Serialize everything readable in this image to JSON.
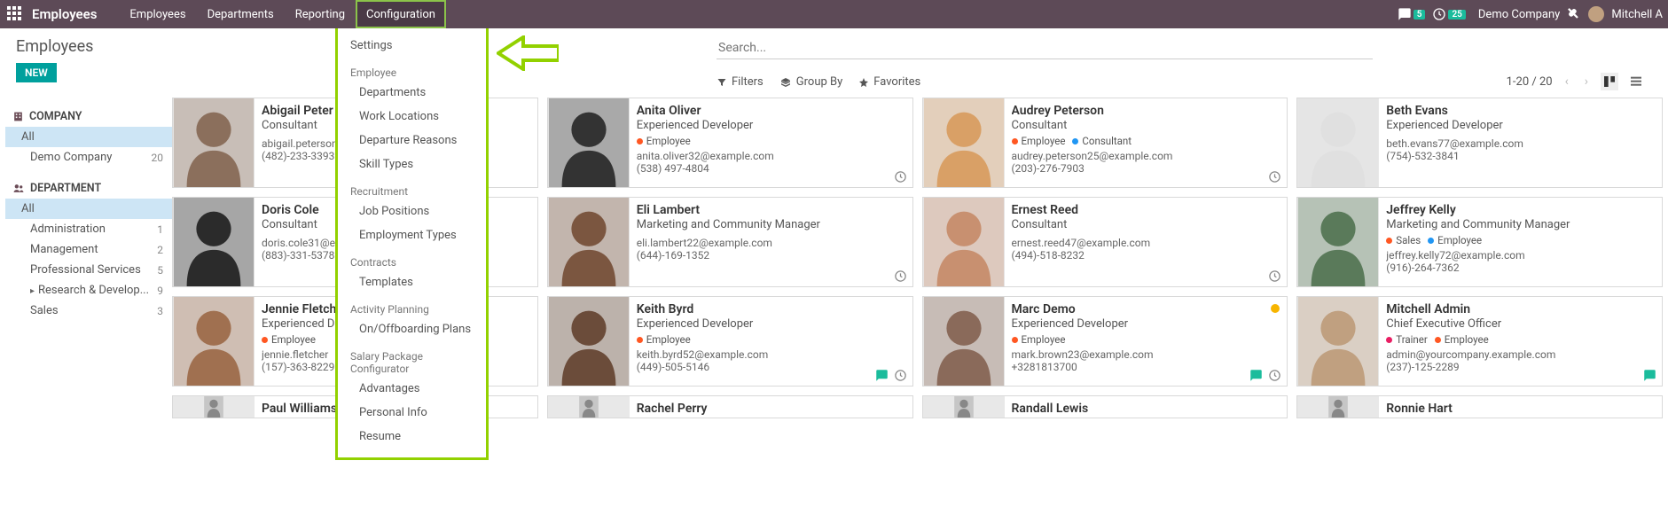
{
  "topnav": {
    "brand": "Employees",
    "items": [
      "Employees",
      "Departments",
      "Reporting",
      "Configuration"
    ],
    "msg_count": "5",
    "clock_count": "25",
    "company": "Demo Company",
    "user": "Mitchell A"
  },
  "page": {
    "title": "Employees",
    "new_btn": "NEW",
    "search_placeholder": "Search..."
  },
  "filters": {
    "filters": "Filters",
    "group_by": "Group By",
    "favorites": "Favorites",
    "pager": "1-20 / 20"
  },
  "config_menu": {
    "settings": "Settings",
    "groups": [
      {
        "label": "Employee",
        "items": [
          "Departments",
          "Work Locations",
          "Departure Reasons",
          "Skill Types"
        ]
      },
      {
        "label": "Recruitment",
        "items": [
          "Job Positions",
          "Employment Types"
        ]
      },
      {
        "label": "Contracts",
        "items": [
          "Templates"
        ]
      },
      {
        "label": "Activity Planning",
        "items": [
          "On/Offboarding Plans"
        ]
      },
      {
        "label": "Salary Package Configurator",
        "items": [
          "Advantages",
          "Personal Info",
          "Resume"
        ]
      }
    ]
  },
  "sidebar": {
    "company": {
      "head": "COMPANY",
      "all": "All",
      "items": [
        {
          "l": "Demo Company",
          "c": "20"
        }
      ]
    },
    "department": {
      "head": "DEPARTMENT",
      "all": "All",
      "items": [
        {
          "l": "Administration",
          "c": "1"
        },
        {
          "l": "Management",
          "c": "2"
        },
        {
          "l": "Professional Services",
          "c": "5"
        },
        {
          "l": "Research & Develop...",
          "c": "9",
          "caret": true
        },
        {
          "l": "Sales",
          "c": "3"
        }
      ]
    }
  },
  "employees": [
    {
      "name": "Abigail Peter",
      "role": "Consultant",
      "tags": [],
      "email": "abigail.peterson@e",
      "phone": "(482)-233-3393",
      "clock": false
    },
    {
      "name": "Anita Oliver",
      "role": "Experienced Developer",
      "tags": [
        {
          "t": "Employee",
          "c": "emp"
        }
      ],
      "email": "anita.oliver32@example.com",
      "phone": "(538) 497-4804",
      "clock": true
    },
    {
      "name": "Audrey Peterson",
      "role": "Consultant",
      "tags": [
        {
          "t": "Employee",
          "c": "emp"
        },
        {
          "t": "Consultant",
          "c": "cons"
        }
      ],
      "email": "audrey.peterson25@example.com",
      "phone": "(203)-276-7903",
      "clock": true
    },
    {
      "name": "Beth Evans",
      "role": "Experienced Developer",
      "tags": [],
      "email": "beth.evans77@example.com",
      "phone": "(754)-532-3841",
      "clock": false
    },
    {
      "name": "Doris Cole",
      "role": "Consultant",
      "tags": [],
      "email": "doris.cole31@e",
      "phone": "(883)-331-5378",
      "clock": false
    },
    {
      "name": "Eli Lambert",
      "role": "Marketing and Community Manager",
      "tags": [],
      "email": "eli.lambert22@example.com",
      "phone": "(644)-169-1352",
      "clock": true
    },
    {
      "name": "Ernest Reed",
      "role": "Consultant",
      "tags": [],
      "email": "ernest.reed47@example.com",
      "phone": "(494)-518-8232",
      "clock": true
    },
    {
      "name": "Jeffrey Kelly",
      "role": "Marketing and Community Manager",
      "tags": [
        {
          "t": "Sales",
          "c": "sales"
        },
        {
          "t": "Employee",
          "c": "cons"
        }
      ],
      "email": "jeffrey.kelly72@example.com",
      "phone": "(916)-264-7362",
      "clock": false
    },
    {
      "name": "Jennie Fletcher",
      "role": "Experienced De",
      "tags": [
        {
          "t": "Employee",
          "c": "emp"
        }
      ],
      "email": "jennie.fletcher",
      "phone": "(157)-363-8229",
      "clock": false
    },
    {
      "name": "Keith Byrd",
      "role": "Experienced Developer",
      "tags": [
        {
          "t": "Employee",
          "c": "emp"
        }
      ],
      "email": "keith.byrd52@example.com",
      "phone": "(449)-505-5146",
      "clock": true,
      "chat": true
    },
    {
      "name": "Marc Demo",
      "role": "Experienced Developer",
      "tags": [
        {
          "t": "Employee",
          "c": "emp"
        }
      ],
      "email": "mark.brown23@example.com",
      "phone": "+3281813700",
      "clock": true,
      "chat": true,
      "yellow": true
    },
    {
      "name": "Mitchell Admin",
      "role": "Chief Executive Officer",
      "tags": [
        {
          "t": "Trainer",
          "c": "trn"
        },
        {
          "t": "Employee",
          "c": "emp"
        }
      ],
      "email": "admin@yourcompany.example.com",
      "phone": "(237)-125-2289",
      "clock": false,
      "chat": true
    },
    {
      "name": "Paul Williams",
      "role": "",
      "tags": [],
      "email": "",
      "phone": "",
      "clock": false
    },
    {
      "name": "Rachel Perry",
      "role": "",
      "tags": [],
      "email": "",
      "phone": "",
      "clock": false
    },
    {
      "name": "Randall Lewis",
      "role": "",
      "tags": [],
      "email": "",
      "phone": "",
      "clock": false
    },
    {
      "name": "Ronnie Hart",
      "role": "",
      "tags": [],
      "email": "",
      "phone": "",
      "clock": false
    }
  ]
}
